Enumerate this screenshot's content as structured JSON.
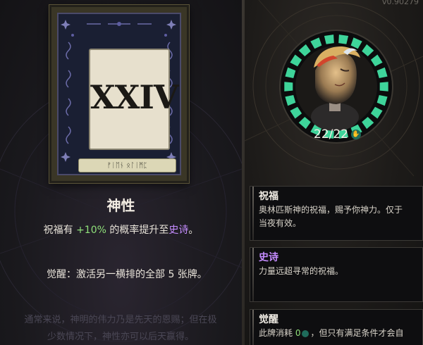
{
  "version": "v0.90279",
  "card": {
    "numeral": "XXIV",
    "scroll_text": "ᚠᛁᛖᚾ ᛟᛚᛁᛗᛈ",
    "title": "神性",
    "effect": {
      "prefix": "祝福有 ",
      "value": "+10%",
      "middle": " 的概率提升至",
      "rarity": "史诗",
      "suffix": "。"
    },
    "awaken": "觉醒：激活另一横排的全部 5 张牌。",
    "flavor_line1": "通常来说，神明的伟力乃是先天的恩赐；但在极",
    "flavor_line2": "少数情况下，神性亦可以后天赢得。"
  },
  "portrait": {
    "health": "22/22",
    "icon": "hand-icon",
    "accent": "#3ed49a"
  },
  "tooltips": [
    {
      "title": "祝福",
      "line1": "奥林匹斯神的祝福，赐予你神力。仅于",
      "line2": "当夜有效。"
    },
    {
      "title": "史诗",
      "line1": "力量远超寻常的祝福。"
    },
    {
      "title": "觉醒",
      "prefix": "此牌消耗 ",
      "value": "0",
      "suffix": "，但只有满足条件才会自"
    }
  ]
}
